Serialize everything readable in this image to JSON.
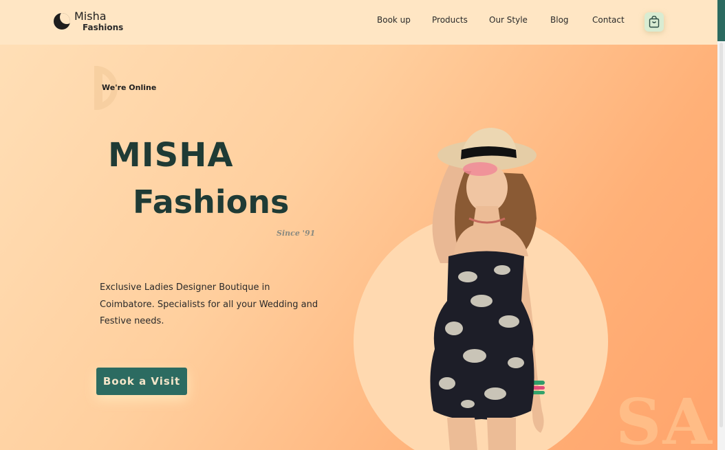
{
  "brand": {
    "name_line1": "Misha",
    "name_line2": "Fashions",
    "icon": "crescent-moon-icon"
  },
  "nav": {
    "items": [
      {
        "label": "Book up"
      },
      {
        "label": "Products"
      },
      {
        "label": "Our Style"
      },
      {
        "label": "Blog"
      },
      {
        "label": "Contact"
      }
    ],
    "cart_icon": "shopping-bag-icon"
  },
  "hero": {
    "online_label": "We're Online",
    "title_line1": "MISHA",
    "title_line2": "Fashions",
    "since": "Since '91",
    "description": "Exclusive Ladies Designer Boutique in Coimbatore. Specialists for all your Wedding and Festive needs.",
    "cta_label": "Book a Visit",
    "watermark": "SA"
  },
  "colors": {
    "accent": "#2c6b61",
    "heading": "#1f3b35",
    "header_bg": "#ffe6c4",
    "gradient_start": "#ffe0b8",
    "gradient_end": "#ffa46c"
  }
}
